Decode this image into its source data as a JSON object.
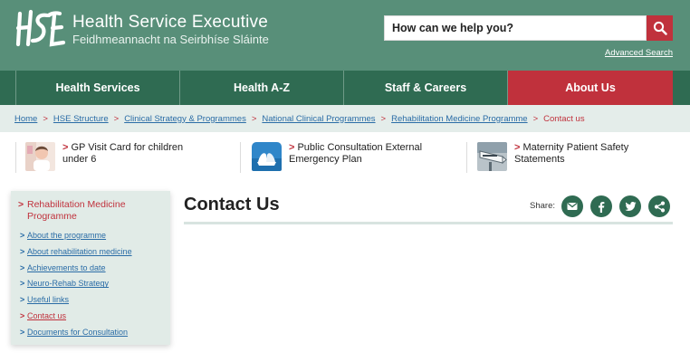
{
  "header": {
    "logo_text": "HSE",
    "title": "Health Service Executive",
    "subtitle": "Feidhmeannacht na Seirbhíse Sláinte",
    "search_placeholder": "How can we help you?",
    "advanced_search": "Advanced Search",
    "search_icon": "search-icon"
  },
  "nav": {
    "items": [
      {
        "label": "Health Services",
        "active": false
      },
      {
        "label": "Health A-Z",
        "active": false
      },
      {
        "label": "Staff & Careers",
        "active": false
      },
      {
        "label": "About Us",
        "active": true
      }
    ]
  },
  "breadcrumb": {
    "items": [
      "Home",
      "HSE Structure",
      "Clinical Strategy & Programmes",
      "National Clinical Programmes",
      "Rehabilitation Medicine Programme"
    ],
    "current": "Contact us",
    "separator": ">"
  },
  "promos": [
    {
      "line1": "GP Visit Card for children",
      "line2": "under 6",
      "icon": "child-photo-thumb"
    },
    {
      "line1": "Public Consultation External",
      "line2": "Emergency Plan",
      "icon": "hands-icon"
    },
    {
      "line1": "Maternity Patient Safety",
      "line2": "Statements",
      "icon": "maternity-sign-thumb"
    }
  ],
  "sidebar": {
    "heading": "Rehabilitation Medicine Programme",
    "links": [
      {
        "label": "About the programme",
        "current": false
      },
      {
        "label": "About rehabilitation medicine",
        "current": false
      },
      {
        "label": "Achievements to date",
        "current": false
      },
      {
        "label": "Neuro-Rehab Strategy",
        "current": false
      },
      {
        "label": "Useful links",
        "current": false
      },
      {
        "label": "Contact us",
        "current": true
      },
      {
        "label": "Documents for Consultation",
        "current": false
      }
    ]
  },
  "main": {
    "title": "Contact Us",
    "share_label": "Share:",
    "share_buttons": [
      "email-icon",
      "facebook-icon",
      "twitter-icon",
      "share-icon"
    ]
  },
  "colors": {
    "header_green": "#588f79",
    "nav_green": "#2f6b52",
    "accent_red": "#c0313c",
    "link_blue": "#2a6ca6",
    "breadcrumb_bg": "#e4edea",
    "sidebar_bg": "#e1ebe7"
  }
}
